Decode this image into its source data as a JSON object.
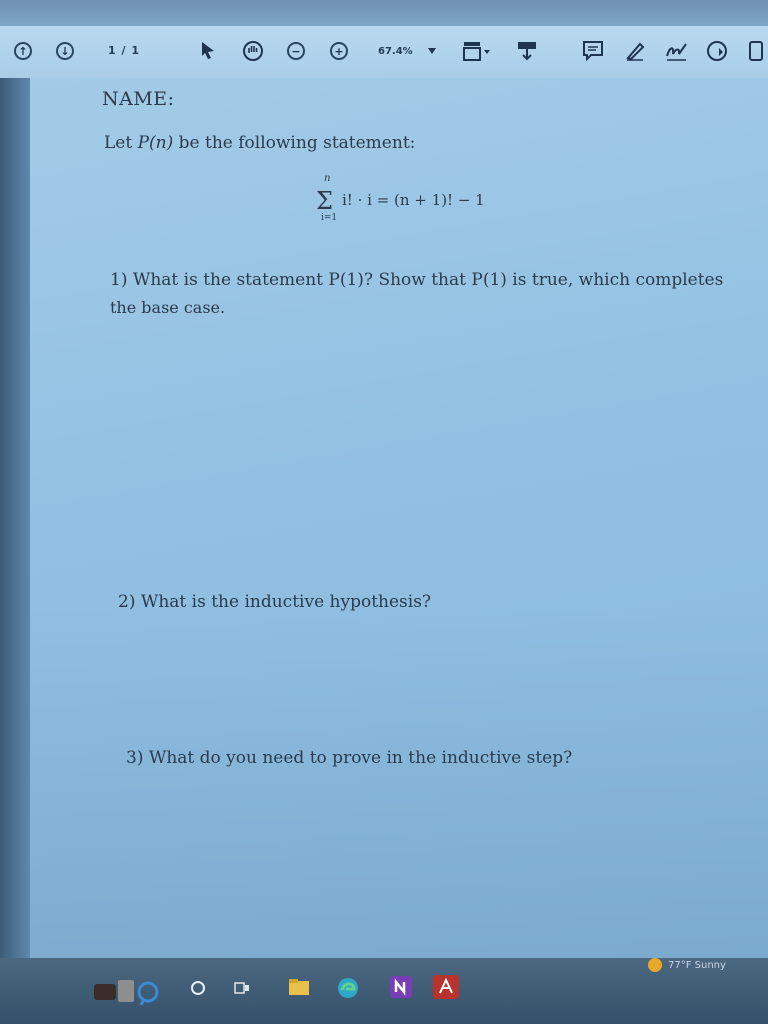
{
  "toolbar": {
    "page_indicator": "1 / 1",
    "zoom": "67.4%",
    "icons": [
      "page-up-icon",
      "page-down-icon",
      "select-arrow-icon",
      "hand-icon",
      "zoom-out-icon",
      "zoom-in-icon",
      "fit-page-icon",
      "download-icon",
      "comment-icon",
      "pen-icon",
      "sign-icon",
      "share-icon",
      "tools-icon"
    ]
  },
  "document": {
    "name_label": "NAME:",
    "intro": {
      "before": "Let ",
      "func": "P(n)",
      "after": " be the following statement:"
    },
    "formula": {
      "upper_limit": "n",
      "lower_limit": "i=1",
      "expression": "i! · i = (n + 1)! − 1"
    },
    "questions": [
      {
        "line1": "1) What is the statement P(1)? Show that P(1) is true, which completes",
        "line2": "the base case."
      },
      {
        "line1": "2) What is the inductive hypothesis?"
      },
      {
        "line1": "3) What do you need to prove in the inductive step?"
      }
    ]
  },
  "taskbar": {
    "apps": [
      "widgets-icon",
      "search-icon",
      "task-view-icon",
      "file-explorer-icon",
      "edge-icon",
      "onenote-icon",
      "acrobat-icon"
    ],
    "weather": "77°F Sunny"
  }
}
